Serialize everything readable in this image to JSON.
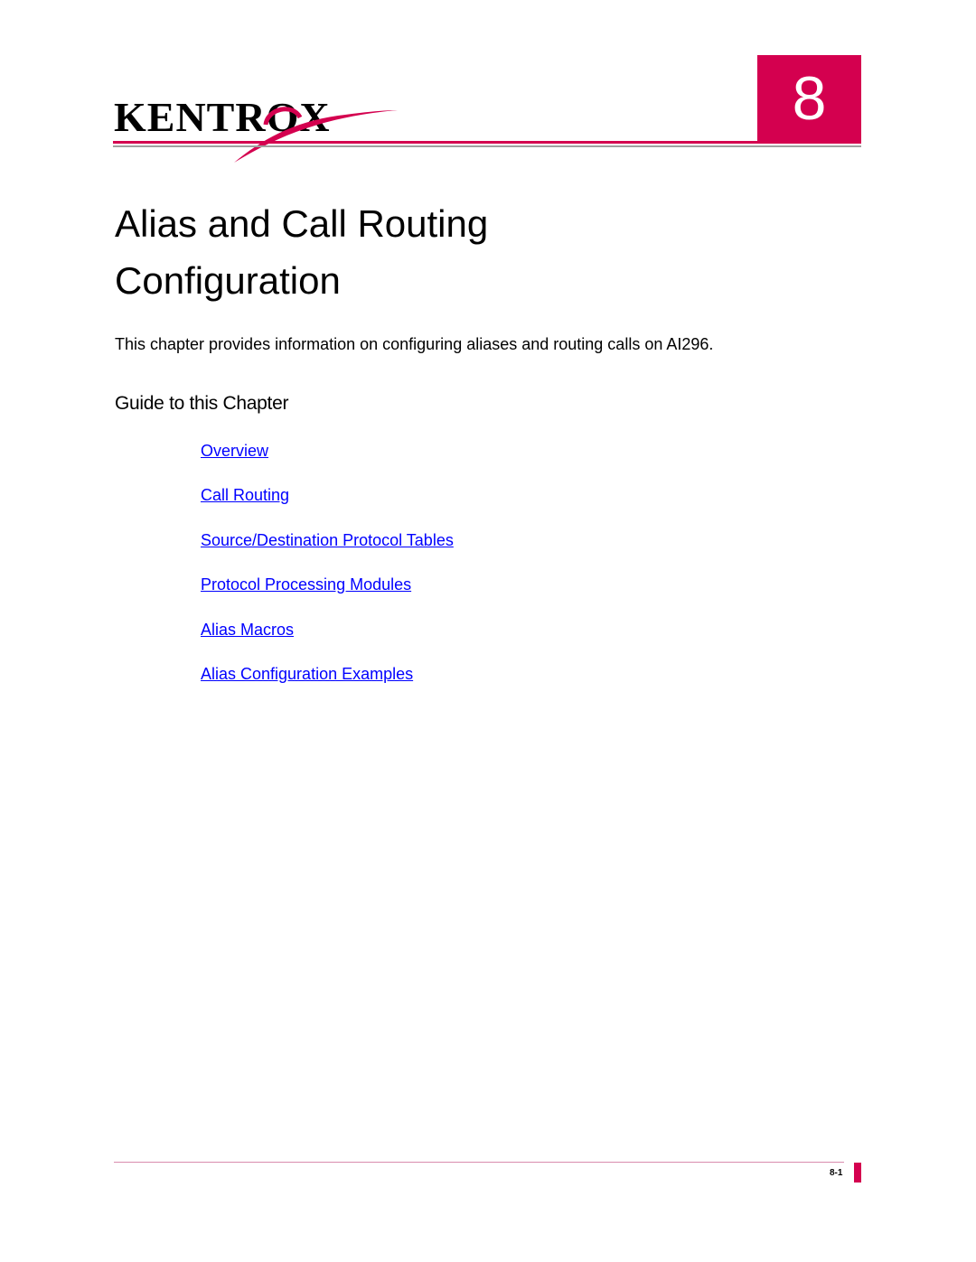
{
  "header": {
    "logo_text": "KENTROX",
    "chapter_number": "8",
    "accent_color": "#d4004f"
  },
  "title": {
    "line1": "Alias and Call Routing",
    "line2": "Configuration"
  },
  "intro": "This chapter provides information on configuring aliases and routing calls on AI296.",
  "guide": {
    "heading": "Guide to this Chapter",
    "links": [
      "Overview",
      "Call Routing",
      "Source/Destination Protocol Tables",
      "Protocol Processing Modules",
      "Alias Macros",
      "Alias Configuration Examples"
    ]
  },
  "footer": {
    "page_number": "8-1"
  }
}
